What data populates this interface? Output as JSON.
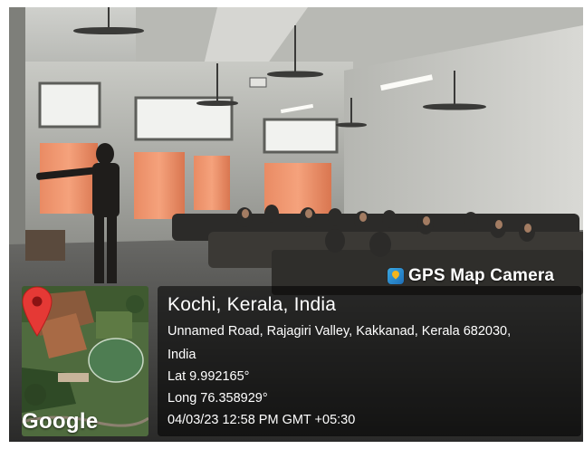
{
  "app_badge": {
    "name": "GPS Map Camera",
    "icon": "gps-map-camera-icon",
    "accent": "#1e6fb8"
  },
  "map": {
    "logo_text": "Google",
    "pin_icon": "location-pin-icon",
    "pin_color": "#e53935"
  },
  "location": {
    "title": "Kochi, Kerala, India",
    "address_line1": "Unnamed Road, Rajagiri Valley, Kakkanad, Kerala 682030,",
    "address_line2": "India",
    "latitude": "Lat 9.992165°",
    "longitude": "Long 76.358929°",
    "timestamp": "04/03/23 12:58 PM GMT +05:30"
  }
}
